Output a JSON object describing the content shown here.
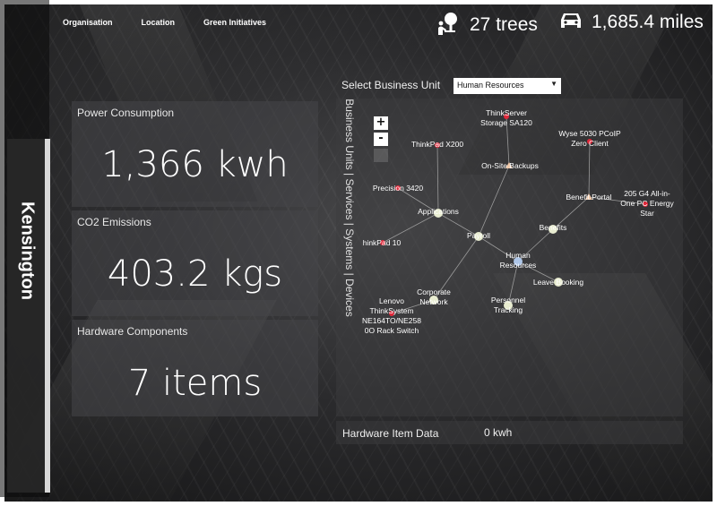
{
  "nav": [
    "Organisation",
    "Location",
    "Green Initiatives"
  ],
  "location_title": "Kensington",
  "stats": {
    "trees": "27 trees",
    "miles": "1,685.4 miles",
    "trees_icon": "tree-person-icon",
    "miles_icon": "car-icon"
  },
  "cards": {
    "power": {
      "label": "Power Consumption",
      "value": "1,366 kwh"
    },
    "co2": {
      "label": "CO2 Emissions",
      "value": "403.2 kgs"
    },
    "hardware": {
      "label": "Hardware Components",
      "value": "7 items"
    }
  },
  "business_unit": {
    "label": "Select Business Unit",
    "selected": "Human Resources"
  },
  "graph": {
    "vertical_label": "Business Units | Services | Systems | Devices",
    "zoom_in": "+",
    "zoom_out": "-",
    "nodes": [
      {
        "id": "thinkserver",
        "label": [
          "ThinkServer",
          "Storage SA120"
        ],
        "type": "device"
      },
      {
        "id": "wyse",
        "label": [
          "Wyse 5030 PCoIP",
          "Zero Client"
        ],
        "type": "device"
      },
      {
        "id": "thinkpad-x200",
        "label": [
          "ThinkPad X200"
        ],
        "type": "device"
      },
      {
        "id": "onsite-backups",
        "label": [
          "On-Site Backups"
        ],
        "type": "system"
      },
      {
        "id": "benefit-portal",
        "label": [
          "Benefit Portal"
        ],
        "type": "system"
      },
      {
        "id": "hp-205",
        "label": [
          "205 G4 All-in-",
          "One PC Energy",
          "Star"
        ],
        "type": "device"
      },
      {
        "id": "precision",
        "label": [
          "Precision 3420"
        ],
        "type": "device"
      },
      {
        "id": "applications",
        "label": [
          "Applications"
        ],
        "type": "service"
      },
      {
        "id": "benefits",
        "label": [
          "Benefits"
        ],
        "type": "service"
      },
      {
        "id": "thinkpad-10",
        "label": [
          "hinkPad 10"
        ],
        "type": "device"
      },
      {
        "id": "payroll",
        "label": [
          "Payroll"
        ],
        "type": "service"
      },
      {
        "id": "human-resources",
        "label": [
          "Human",
          "Resources"
        ],
        "type": "unit"
      },
      {
        "id": "leave-booking",
        "label": [
          "Leave Booking"
        ],
        "type": "service"
      },
      {
        "id": "lenovo-switch",
        "label": [
          "Lenovo",
          "ThinkSystem",
          "NE164TO/NE258",
          "0O Rack Switch"
        ],
        "type": "device"
      },
      {
        "id": "corporate-network",
        "label": [
          "Corporate",
          "Network"
        ],
        "type": "service"
      },
      {
        "id": "personnel-tracking",
        "label": [
          "Personnel",
          "Tracking"
        ],
        "type": "service"
      }
    ]
  },
  "hardware_item": {
    "label": "Hardware Item Data",
    "value": "0 kwh"
  },
  "colors": {
    "device": "#e0283a",
    "system": "#f0c8a8",
    "service": "#e8ecd0",
    "unit": "#aec6e8",
    "link": "#9a9a9a",
    "divider": "#d8d8d8"
  }
}
